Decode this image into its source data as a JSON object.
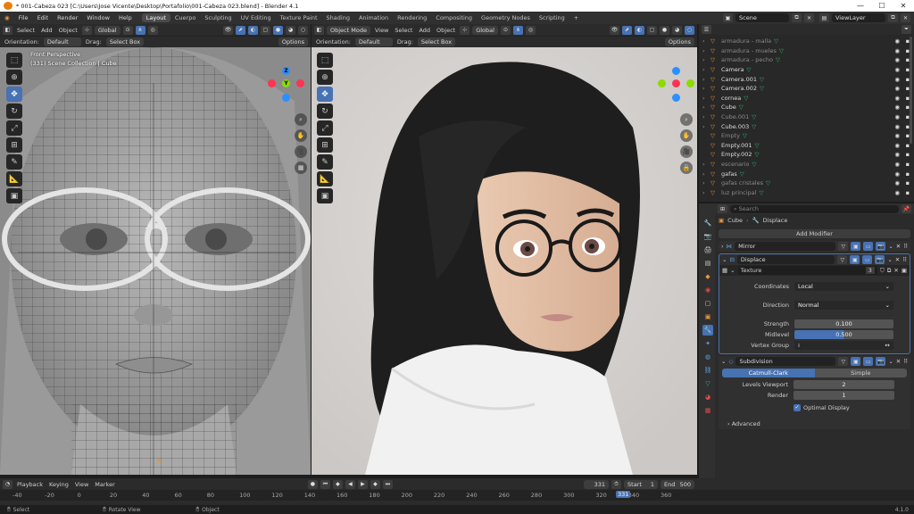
{
  "window": {
    "title": "* 001-Cabeza 023 [C:\\Users\\Jose Vicente\\Desktop\\Portafolio\\001-Cabeza 023.blend] - Blender 4.1"
  },
  "menu": [
    "File",
    "Edit",
    "Render",
    "Window",
    "Help"
  ],
  "workspaces": [
    "Layout",
    "Cuerpo",
    "Sculpting",
    "UV Editing",
    "Texture Paint",
    "Shading",
    "Animation",
    "Rendering",
    "Compositing",
    "Geometry Nodes",
    "Scripting",
    "+"
  ],
  "active_workspace": "Layout",
  "top_right": {
    "scene": "Scene",
    "view_layer": "ViewLayer"
  },
  "left_viewport": {
    "header": {
      "select": "Select",
      "add": "Add",
      "object": "Object",
      "transform": "Global"
    },
    "sub": {
      "orientation_label": "Orientation:",
      "orientation": "Default",
      "drag_label": "Drag:",
      "drag": "Select Box",
      "options": "Options"
    },
    "overlay_title": "Front Perspective",
    "overlay_sub": "(331) Scene Collection | Cube"
  },
  "right_viewport": {
    "header": {
      "mode": "Object Mode",
      "view": "View",
      "select": "Select",
      "add": "Add",
      "object": "Object",
      "transform": "Global"
    },
    "sub": {
      "orientation_label": "Orientation:",
      "orientation": "Default",
      "drag_label": "Drag:",
      "drag": "Select Box",
      "options": "Options"
    }
  },
  "outliner": [
    {
      "name": "armadura - malla",
      "dim": true,
      "expand": true
    },
    {
      "name": "armadura - mueles",
      "dim": true,
      "expand": true
    },
    {
      "name": "armadura - pecho",
      "dim": true,
      "expand": true
    },
    {
      "name": "Camera",
      "dim": false,
      "expand": true
    },
    {
      "name": "Camera.001",
      "dim": false,
      "expand": true
    },
    {
      "name": "Camera.002",
      "dim": false,
      "expand": true
    },
    {
      "name": "cornea",
      "dim": false,
      "expand": true
    },
    {
      "name": "Cube",
      "dim": false,
      "expand": true
    },
    {
      "name": "Cube.001",
      "dim": true,
      "expand": true
    },
    {
      "name": "Cube.003",
      "dim": false,
      "expand": true
    },
    {
      "name": "Empty",
      "dim": true,
      "expand": false
    },
    {
      "name": "Empty.001",
      "dim": false,
      "expand": false
    },
    {
      "name": "Empty.002",
      "dim": false,
      "expand": false
    },
    {
      "name": "escenario",
      "dim": true,
      "expand": true
    },
    {
      "name": "gafas",
      "dim": false,
      "expand": true
    },
    {
      "name": "gafas cristales",
      "dim": true,
      "expand": true
    },
    {
      "name": "luz principal",
      "dim": true,
      "expand": true
    }
  ],
  "properties": {
    "search_placeholder": "Search",
    "breadcrumb_object": "Cube",
    "breadcrumb_mod": "Displace",
    "add_modifier": "Add Modifier",
    "mirror": "Mirror",
    "displace": {
      "name": "Displace",
      "texture_label": "Texture",
      "texture_users": "3",
      "coordinates_label": "Coordinates",
      "coordinates": "Local",
      "direction_label": "Direction",
      "direction": "Normal",
      "strength_label": "Strength",
      "strength": "0.100",
      "midlevel_label": "Midlevel",
      "midlevel": "0.500",
      "vgroup_label": "Vertex Group"
    },
    "subdivision": {
      "name": "Subdivision",
      "tab1": "Catmull-Clark",
      "tab2": "Simple",
      "levels_label": "Levels Viewport",
      "levels": "2",
      "render_label": "Render",
      "render": "1",
      "optimal": "Optimal Display",
      "advanced": "Advanced"
    }
  },
  "timeline": {
    "playback": "Playback",
    "keying": "Keying",
    "view": "View",
    "marker": "Marker",
    "current_frame": "331",
    "start_label": "Start",
    "start": "1",
    "end_label": "End",
    "end": "500",
    "ticks": [
      "-40",
      "-20",
      "0",
      "20",
      "40",
      "60",
      "80",
      "100",
      "120",
      "140",
      "160",
      "180",
      "200",
      "220",
      "240",
      "260",
      "280",
      "300",
      "320",
      "340",
      "360"
    ],
    "playhead": "331"
  },
  "status": {
    "select": "Select",
    "rotate": "Rotate View",
    "object": "Object",
    "version": "4.1.0"
  },
  "colors": {
    "accent": "#4772b3",
    "orange": "#e8953a",
    "green": "#2fb36f"
  }
}
